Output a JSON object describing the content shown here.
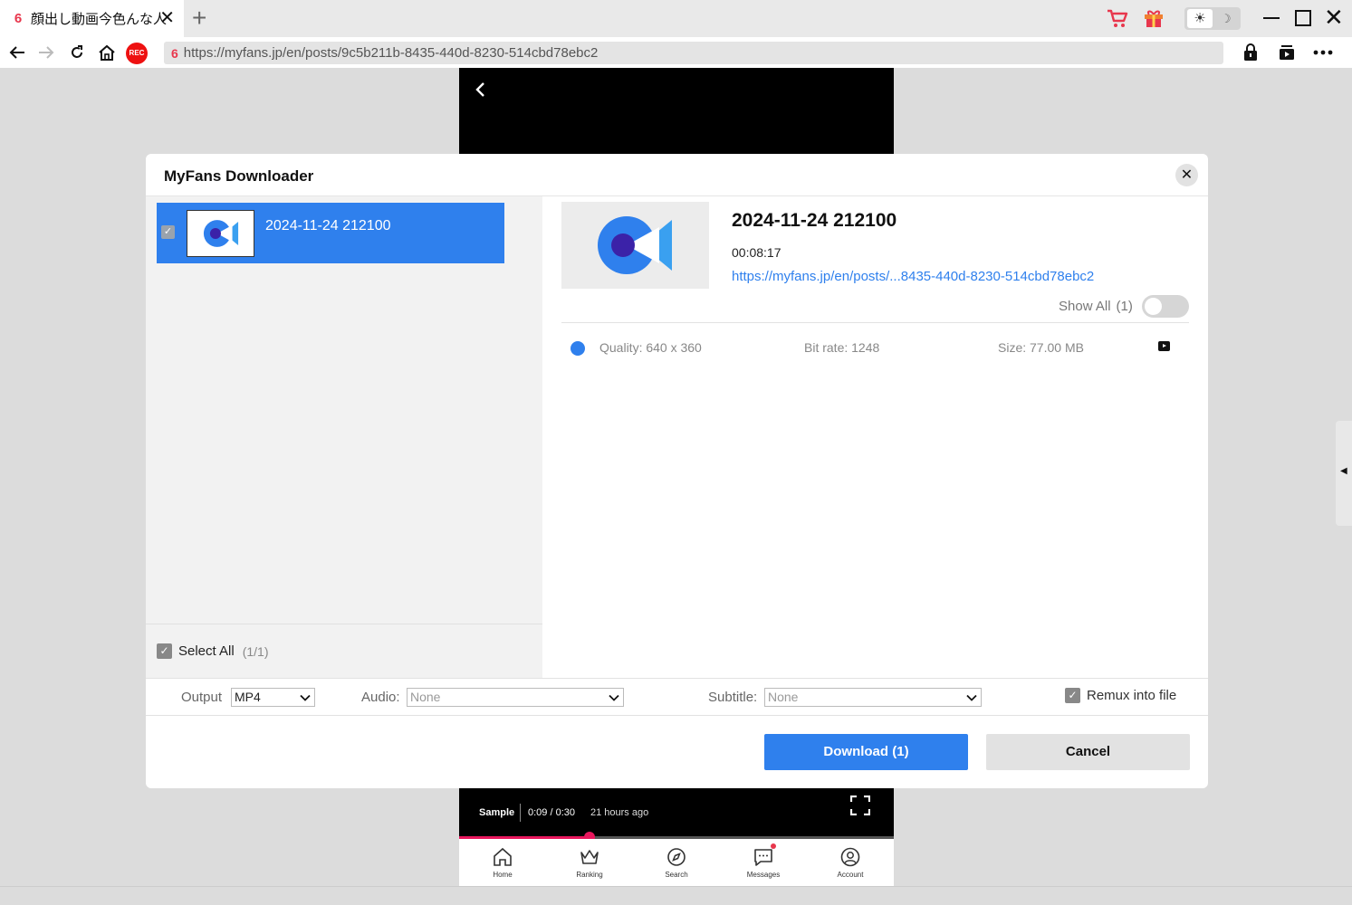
{
  "browser": {
    "tab_title": "顔出し動画今色んな人",
    "tab_favicon": "6",
    "url_favicon": "6",
    "url": "https://myfans.jp/en/posts/9c5b211b-8435-440d-8230-514cbd78ebc2",
    "rec_label": "REC",
    "tab_close_glyph": "✕",
    "new_tab_glyph": "+",
    "sun_glyph": "☀",
    "moon_glyph": "☽",
    "win_close_glyph": "✕",
    "accent_color": "#e8374d"
  },
  "page": {
    "video": {
      "sample_label": "Sample",
      "time": "0:09 / 0:30",
      "posted": "21 hours ago",
      "progress_fraction": 0.3
    },
    "bottom_nav": [
      {
        "label": "Home",
        "icon": "home-icon"
      },
      {
        "label": "Ranking",
        "icon": "crown-icon"
      },
      {
        "label": "Search",
        "icon": "compass-icon"
      },
      {
        "label": "Messages",
        "icon": "message-icon"
      },
      {
        "label": "Account",
        "icon": "account-icon"
      }
    ]
  },
  "dialog": {
    "title": "MyFans Downloader",
    "close_glyph": "✕",
    "items": [
      {
        "title": "2024-11-24 212100",
        "checked": true
      }
    ],
    "select_all_label": "Select All",
    "select_all_count": "(1/1)",
    "detail": {
      "title": "2024-11-24 212100",
      "duration": "00:08:17",
      "url": "https://myfans.jp/en/posts/...8435-440d-8230-514cbd78ebc2",
      "show_all_label": "Show All",
      "show_all_count": "(1)",
      "quality": "Quality: 640 x 360",
      "bitrate": "Bit rate: 1248",
      "size": "Size: 77.00 MB"
    },
    "options": {
      "output_label": "Output",
      "output_value": "MP4",
      "audio_label": "Audio:",
      "audio_value": "None",
      "subtitle_label": "Subtitle:",
      "subtitle_value": "None",
      "remux_label": "Remux into file"
    },
    "download_label": "Download (1)",
    "cancel_label": "Cancel",
    "primary_color": "#2f80ed"
  }
}
